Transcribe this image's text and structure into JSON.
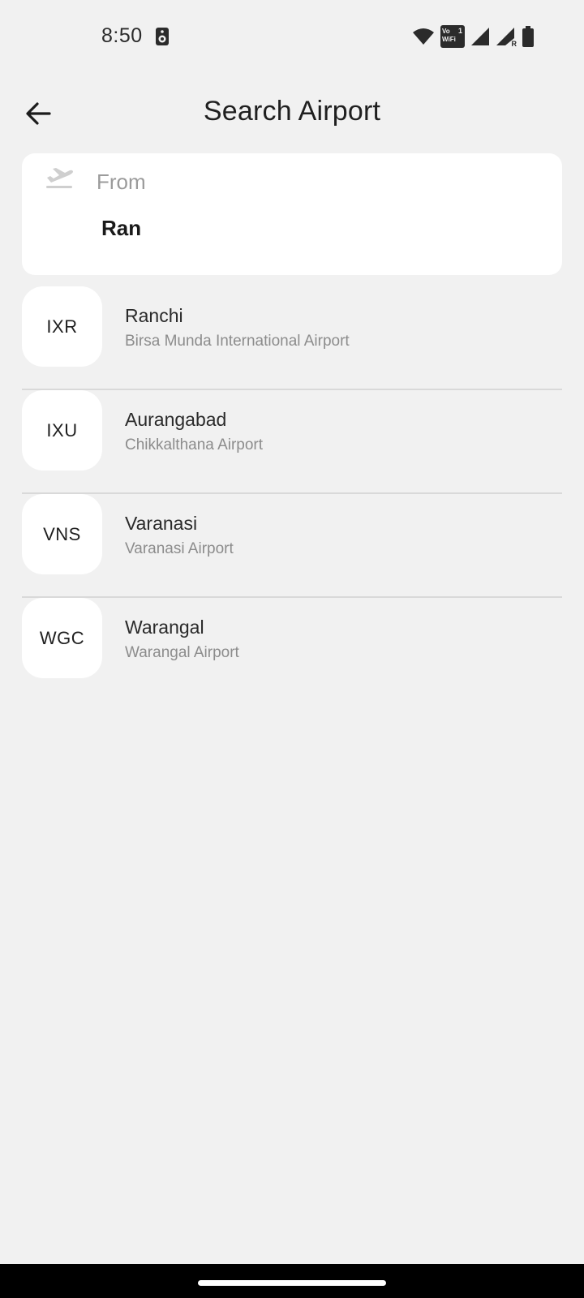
{
  "status_bar": {
    "time": "8:50",
    "icons": [
      "media-icon",
      "wifi-icon",
      "vowifi-icon",
      "signal-icon",
      "signal-roaming-icon",
      "battery-icon"
    ],
    "vowifi_text": "Vo WiFi",
    "vowifi_badge": "1",
    "roaming_letter": "R"
  },
  "header": {
    "title": "Search Airport",
    "back_icon": "arrow-left-icon"
  },
  "from_card": {
    "icon": "takeoff-icon",
    "label": "From",
    "value": "Ran"
  },
  "results": [
    {
      "code": "IXR",
      "city": "Ranchi",
      "airport": "Birsa Munda International Airport"
    },
    {
      "code": "IXU",
      "city": "Aurangabad",
      "airport": "Chikkalthana Airport"
    },
    {
      "code": "VNS",
      "city": "Varanasi",
      "airport": "Varanasi Airport"
    },
    {
      "code": "WGC",
      "city": "Warangal",
      "airport": "Warangal Airport"
    }
  ],
  "colors": {
    "background": "#f1f1f1",
    "card": "#ffffff",
    "secondary_text": "#8c8c8c",
    "divider": "#d9d9d9"
  }
}
